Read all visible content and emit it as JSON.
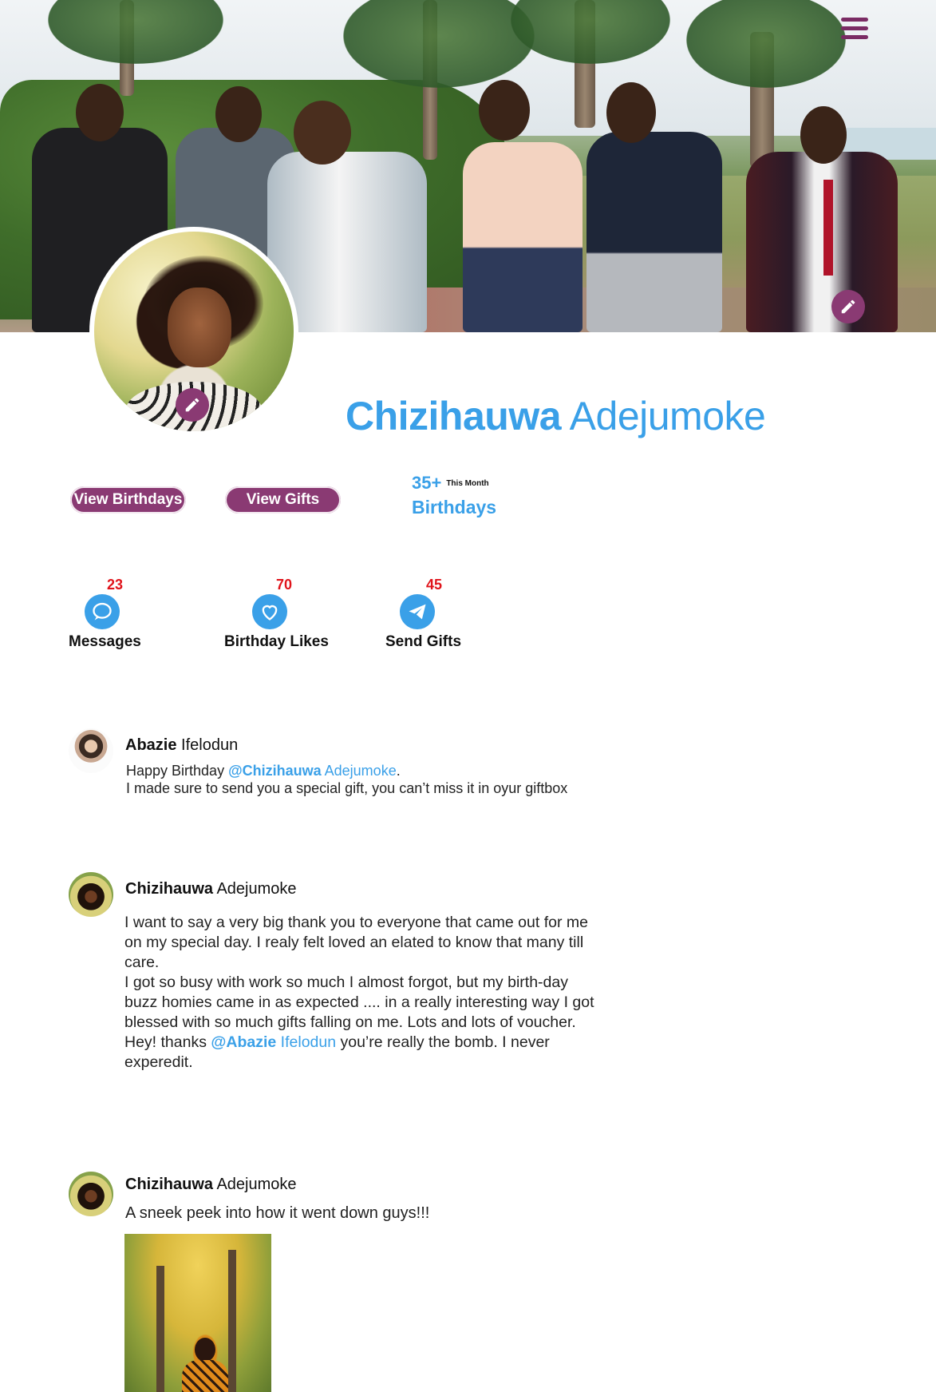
{
  "profile": {
    "first_name": "Chizihauwa",
    "last_name": "Adejumoke"
  },
  "actions": {
    "view_birthdays": "View Birthdays",
    "view_gifts": "View Gifts"
  },
  "birthdays_stat": {
    "count": "35+",
    "period": "This Month",
    "label": "Birthdays"
  },
  "stats": [
    {
      "count": "23",
      "label": "Messages",
      "icon": "chat-bubble-icon"
    },
    {
      "count": "70",
      "label": "Birthday Likes",
      "icon": "heart-icon"
    },
    {
      "count": "45",
      "label": "Send Gifts",
      "icon": "paper-plane-icon"
    }
  ],
  "posts": [
    {
      "author_first": "Abazie",
      "author_last": "Ifelodun",
      "line1_prefix": "Happy Birthday ",
      "mention_first": "@Chizihauwa",
      "mention_last": " Adejumoke",
      "line1_suffix": ".",
      "line2": "I made sure to send you a special gift, you can’t miss it in oyur giftbox"
    },
    {
      "author_first": "Chizihauwa",
      "author_last": "Adejumoke",
      "paragraph1": "I want to say a very big thank you to everyone that came out for me on my special day. I realy felt loved an elated to know that many till care.",
      "paragraph2": "I got so busy with work so much I almost forgot, but my birth-day buzz homies came in as expected .... in a really interesting way I got blessed with so much gifts falling on me. Lots and lots of voucher.",
      "p3_prefix": "Hey! thanks ",
      "mention_first": "@Abazie",
      "mention_last": " Ifelodun",
      "p3_suffix": " you’re really the bomb. I never experedit."
    },
    {
      "author_first": "Chizihauwa",
      "author_last": "Adejumoke",
      "text": "A sneek peek into how it went down guys!!!"
    }
  ],
  "colors": {
    "accent_purple": "#8a3a73",
    "accent_blue": "#3aa0e8",
    "badge_red": "#e0141b"
  }
}
